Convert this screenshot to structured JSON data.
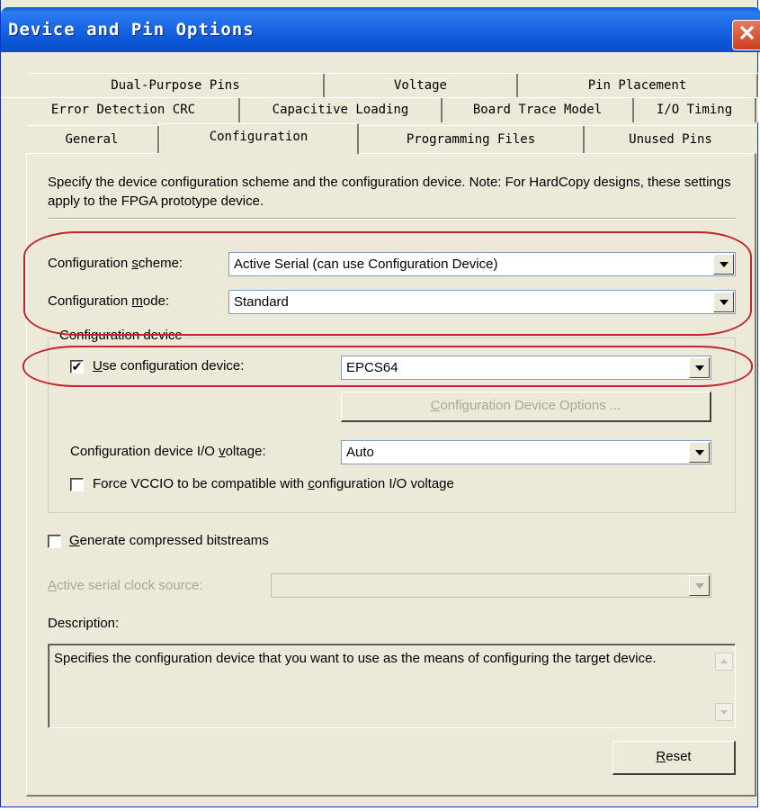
{
  "window": {
    "title": "Device and Pin Options",
    "close_glyph": "✕"
  },
  "tabs": {
    "row1": [
      "Dual-Purpose Pins",
      "Voltage",
      "Pin Placement"
    ],
    "row2": [
      "Error Detection CRC",
      "Capacitive Loading",
      "Board Trace Model",
      "I/O Timing"
    ],
    "row3": [
      "General",
      "Configuration",
      "Programming Files",
      "Unused Pins"
    ],
    "active": "Configuration"
  },
  "config": {
    "intro": "Specify the device configuration scheme and the configuration device. Note: For HardCopy designs, these settings apply to the FPGA prototype device.",
    "scheme_label_pre": "Configuration ",
    "scheme_label_key": "s",
    "scheme_label_post": "cheme:",
    "scheme_value": "Active Serial (can use Configuration Device)",
    "mode_label_pre": "Configuration ",
    "mode_label_key": "m",
    "mode_label_post": "ode:",
    "mode_value": "Standard",
    "group_title": "Configuration device",
    "use_device_key": "U",
    "use_device_rest": "se configuration device:",
    "use_device_checked": true,
    "check_glyph": "✔",
    "device_value": "EPCS64",
    "device_options_key": "C",
    "device_options_rest": "onfiguration Device Options ...",
    "io_voltage_pre": "Configuration device I/O ",
    "io_voltage_key": "v",
    "io_voltage_post": "oltage:",
    "io_voltage_value": "Auto",
    "force_vccio_pre": "Force VCCIO to be compatible with ",
    "force_vccio_key": "c",
    "force_vccio_post": "onfiguration I/O voltage",
    "force_vccio_checked": false,
    "compress_key": "G",
    "compress_rest": "enerate compressed bitstreams",
    "compress_checked": false,
    "clock_source_key": "A",
    "clock_source_rest": "ctive serial clock source:",
    "clock_source_value": "",
    "description_label": "Description:",
    "description_text": "Specifies the configuration device that you want to use as the means of configuring the target device.",
    "reset_key": "R",
    "reset_rest": "eset"
  },
  "colors": {
    "title_blue": "#0a5fd8",
    "dialog_bg": "#ece9d8",
    "annotation_red": "#c0262a"
  }
}
